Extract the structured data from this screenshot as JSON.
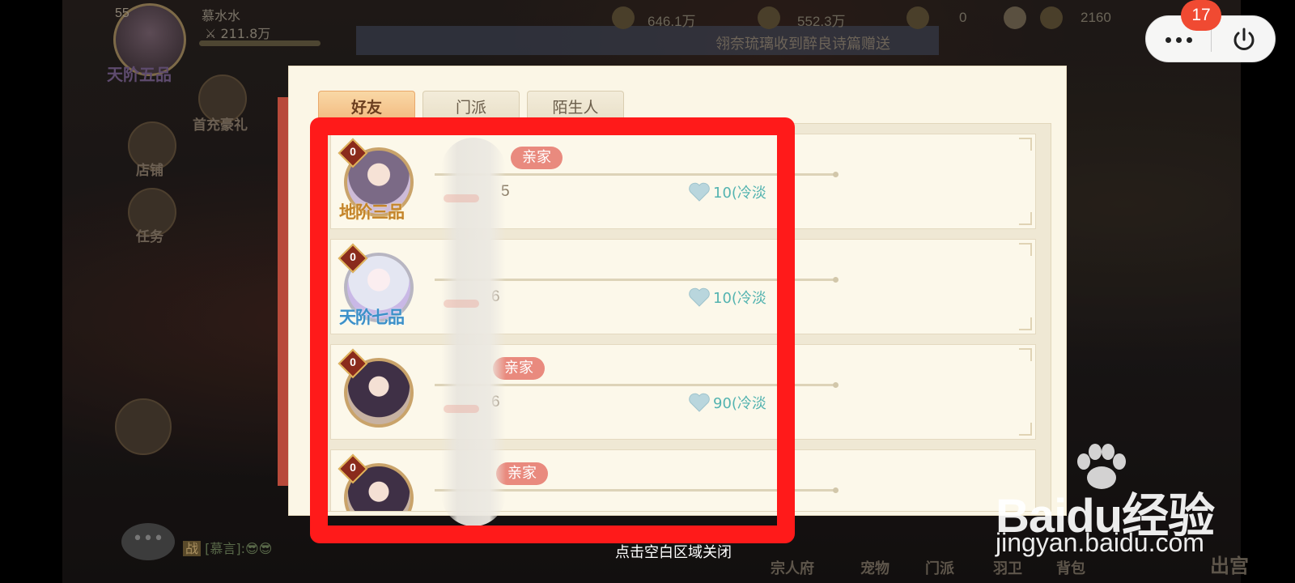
{
  "hud": {
    "level": "55",
    "rank": "天阶五品",
    "name": "慕水水",
    "power": "211.8万",
    "exp": "646.1万",
    "silver": "552.3万",
    "gold": "0",
    "ingot": "2160",
    "announcement": "翎奈琉璃收到醉良诗篇赠送"
  },
  "side_buttons": [
    {
      "label": "首充豪礼"
    },
    {
      "label": "店铺"
    },
    {
      "label": "任务"
    }
  ],
  "bottom_tabs": [
    "宗人府",
    "宠物",
    "门派",
    "羽卫",
    "背包",
    "出宫"
  ],
  "chat": {
    "preview": "[慕言]:😎😎",
    "channel": "战"
  },
  "capsule": {
    "badge": "17"
  },
  "dialog": {
    "tabs": [
      {
        "label": "好友",
        "active": true
      },
      {
        "label": "门派",
        "active": false
      },
      {
        "label": "陌生人",
        "active": false
      }
    ],
    "friends": [
      {
        "level": "0",
        "rank": "地阶三品",
        "rank_style": "gold",
        "avatar": "fairy",
        "tag": "亲家",
        "player_level": "5",
        "intimacy": "10(冷淡"
      },
      {
        "level": "0",
        "rank": "天阶七品",
        "rank_style": "blue",
        "avatar": "silver",
        "tag": "",
        "player_level": "6",
        "intimacy": "10(冷淡"
      },
      {
        "level": "0",
        "rank": "",
        "rank_style": "none",
        "avatar": "dark",
        "tag": "亲家",
        "player_level": "6",
        "intimacy": "90(冷淡"
      },
      {
        "level": "0",
        "rank": "",
        "rank_style": "none",
        "avatar": "dark",
        "tag": "亲家",
        "player_level": "",
        "intimacy": ""
      }
    ],
    "close_hint": "点击空白区域关闭"
  },
  "watermark": {
    "logo": "Baidu经验",
    "url": "jingyan.baidu.com"
  },
  "colors": {
    "highlight": "#ff1a1a",
    "tag_pink": "#e98a7e",
    "intimacy_teal": "#53b3b0",
    "active_tab": "#f2b87d"
  }
}
